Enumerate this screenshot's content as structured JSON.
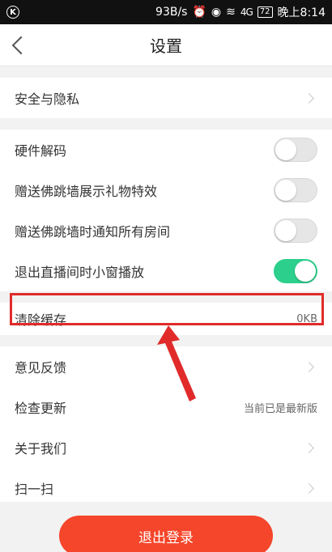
{
  "status_bar": {
    "app_icon": "K",
    "speed": "93B/s",
    "signal": "4G",
    "battery": "72",
    "time": "晚上8:14"
  },
  "header": {
    "title": "设置"
  },
  "groups": [
    {
      "items": [
        {
          "label": "安全与隐私",
          "type": "chevron"
        }
      ]
    },
    {
      "items": [
        {
          "label": "硬件解码",
          "type": "toggle",
          "on": false
        },
        {
          "label": "赠送佛跳墙展示礼物特效",
          "type": "toggle",
          "on": false
        },
        {
          "label": "赠送佛跳墙时通知所有房间",
          "type": "toggle",
          "on": false
        },
        {
          "label": "退出直播间时小窗播放",
          "type": "toggle",
          "on": true
        }
      ]
    },
    {
      "items": [
        {
          "label": "清除缓存",
          "type": "value",
          "value": "0KB"
        }
      ]
    },
    {
      "items": [
        {
          "label": "意见反馈",
          "type": "chevron"
        },
        {
          "label": "检查更新",
          "type": "value",
          "value": "当前已是最新版"
        },
        {
          "label": "关于我们",
          "type": "chevron"
        },
        {
          "label": "扫一扫",
          "type": "chevron"
        }
      ]
    }
  ],
  "logout_label": "退出登录",
  "colors": {
    "accent": "#f5452a",
    "toggle_on": "#2ccf8b",
    "highlight": "#e12b2b"
  }
}
